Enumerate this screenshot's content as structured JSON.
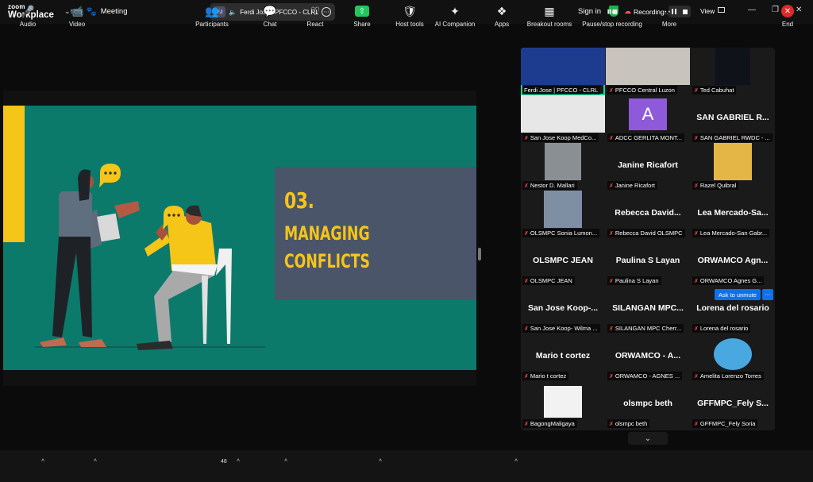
{
  "app": {
    "logo_line1": "zoom",
    "logo_line2": "Workplace",
    "meeting_label": "Meeting"
  },
  "speaker": {
    "initials": "FJ",
    "name": "Ferdi Jose | PFCCO - CLRL's s"
  },
  "topbar": {
    "signin": "Sign in",
    "recording": "Recording...",
    "view": "View"
  },
  "slide": {
    "number": "03.",
    "title_line1": "MANAGING",
    "title_line2": "CONFLICTS"
  },
  "gallery": {
    "tiles": [
      {
        "label": "Ferdi Jose | PFCCO - CLRL",
        "big": ""
      },
      {
        "label": "PFCCO Central Luzon",
        "big": ""
      },
      {
        "label": "Ted Cabuhat",
        "big": ""
      },
      {
        "label": "San Jose Koop MedCo...",
        "big": ""
      },
      {
        "label": "ADCC GERLITA MONT...",
        "big": ""
      },
      {
        "label": "SAN GABRIEL RWDC - ...",
        "big": "SAN GABRIEL R..."
      },
      {
        "label": "Nestor D. Mallari",
        "big": ""
      },
      {
        "label": "Janine Ricafort",
        "big": "Janine Ricafort"
      },
      {
        "label": "Razel Quibral",
        "big": ""
      },
      {
        "label": "OLSMPC Sonia Lumon...",
        "big": ""
      },
      {
        "label": "Rebecca David OLSMPC",
        "big": "Rebecca David..."
      },
      {
        "label": "Lea Mercado-San Gabr...",
        "big": "Lea Mercado-Sa..."
      },
      {
        "label": "OLSMPC JEAN",
        "big": "OLSMPC JEAN"
      },
      {
        "label": "Paulina S Layan",
        "big": "Paulina S Layan"
      },
      {
        "label": "ORWAMCO Agnes G...",
        "big": "ORWAMCO Agn..."
      },
      {
        "label": "San Jose Koop- Wilma ...",
        "big": "San Jose Koop-..."
      },
      {
        "label": "SILANGAN MPC Cherr...",
        "big": "SILANGAN MPC..."
      },
      {
        "label": "Lorena del rosario",
        "big": "Lorena del rosario"
      },
      {
        "label": "Mario t cortez",
        "big": "Mario t cortez"
      },
      {
        "label": "ORWAMCO - AGNES ...",
        "big": "ORWAMCO - A..."
      },
      {
        "label": "Amelita Lorenzo Torres",
        "big": ""
      },
      {
        "label": "BagongMaligaya",
        "big": ""
      },
      {
        "label": "olsmpc beth",
        "big": "olsmpc beth"
      },
      {
        "label": "GFFMPC_Fely Soria",
        "big": "GFFMPC_Fely S..."
      }
    ],
    "avatar_letter": "A",
    "ask_unmute": "Ask to unmute"
  },
  "toolbar": {
    "audio": "Audio",
    "video": "Video",
    "participants": "Participants",
    "participant_count": "48",
    "chat": "Chat",
    "react": "React",
    "share": "Share",
    "host_tools": "Host tools",
    "ai": "AI Companion",
    "apps": "Apps",
    "breakout": "Breakout rooms",
    "record": "Pause/stop recording",
    "more": "More",
    "end": "End"
  },
  "colors": {
    "slide_bg": "#0b7a6b",
    "slide_accent": "#f5c518",
    "panel": "#4b5569",
    "active_speaker": "#1bd39a",
    "end": "#e02828"
  }
}
